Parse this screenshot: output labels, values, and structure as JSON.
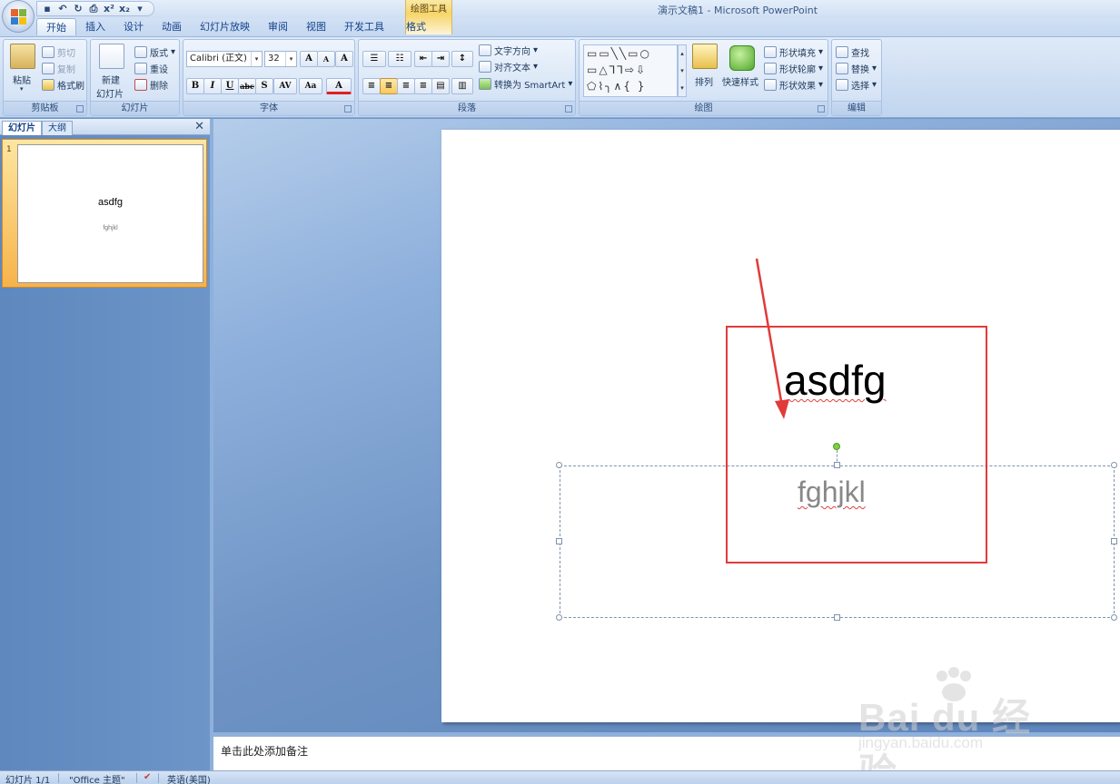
{
  "window": {
    "app_title": "演示文稿1 - Microsoft PowerPoint",
    "contextual_tools": "绘图工具",
    "qat": {
      "save": "▪",
      "undo": "↶",
      "redo": "↻",
      "print_preview": "⎙",
      "superscript": "x²",
      "subscript": "x₂",
      "customize": "▾"
    }
  },
  "tabs": [
    "开始",
    "插入",
    "设计",
    "动画",
    "幻灯片放映",
    "审阅",
    "视图",
    "开发工具",
    "格式"
  ],
  "ribbon": {
    "clipboard": {
      "label": "剪贴板",
      "paste": "粘贴",
      "cut": "剪切",
      "copy": "复制",
      "format_painter": "格式刷"
    },
    "slides": {
      "label": "幻灯片",
      "new_slide_1": "新建",
      "new_slide_2": "幻灯片",
      "layout": "版式",
      "reset": "重设",
      "delete": "删除"
    },
    "font": {
      "label": "字体",
      "family": "Calibri (正文)",
      "size": "32",
      "grow": "A",
      "shrink": "A",
      "clear": "A",
      "bold": "B",
      "italic": "I",
      "underline": "U",
      "strike": "abc",
      "shadow": "S",
      "spacing": "AV",
      "case": "Aa",
      "color": "A"
    },
    "paragraph": {
      "label": "段落",
      "text_direction": "文字方向",
      "align_text": "对齐文本",
      "smartart": "转换为 SmartArt"
    },
    "drawing": {
      "label": "绘图",
      "arrange": "排列",
      "quick_styles": "快速样式",
      "fill": "形状填充",
      "outline": "形状轮廓",
      "effects": "形状效果"
    },
    "editing": {
      "label": "编辑",
      "find": "查找",
      "replace": "替换",
      "select": "选择"
    }
  },
  "left_panel": {
    "tab_slides": "幻灯片",
    "tab_outline": "大纲",
    "close": "✕",
    "thumbnail": {
      "number": "1",
      "title": "asdfg",
      "subtitle": "fghjkl"
    }
  },
  "slide": {
    "title": "asdfg",
    "subtitle": "fghjkl"
  },
  "notes": {
    "placeholder": "单击此处添加备注"
  },
  "watermark": {
    "main": "Bai du 经验",
    "sub": "jingyan.baidu.com"
  },
  "statusbar": {
    "slide_pos": "幻灯片 1/1",
    "theme": "\"Office 主题\"",
    "language": "英语(美国)"
  },
  "colors": {
    "annotation_red": "#e23a3a",
    "selection_dash": "#7f93ad",
    "rotation_handle": "#7cd042"
  }
}
